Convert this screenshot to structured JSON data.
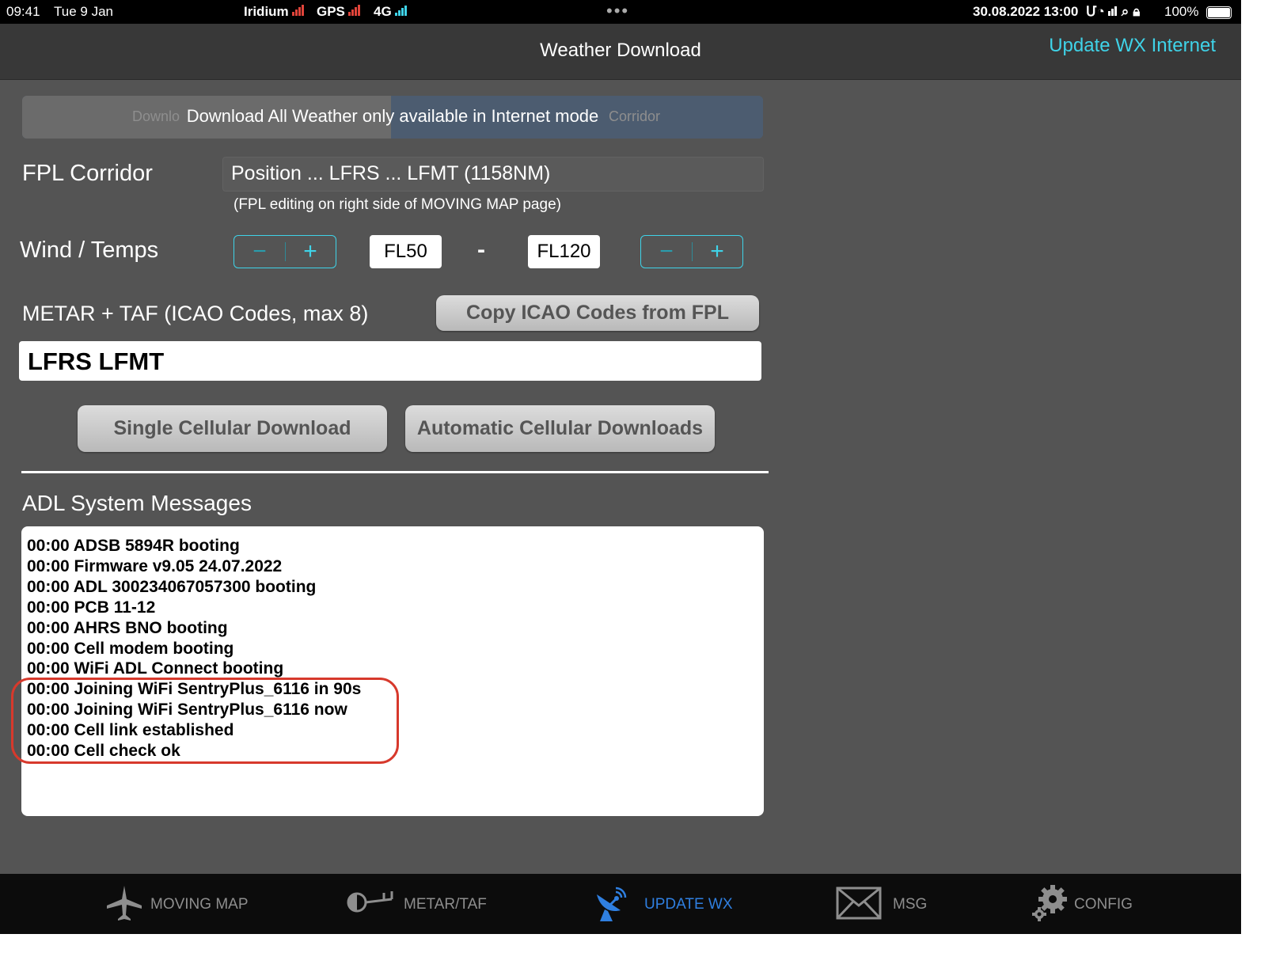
{
  "status_bar": {
    "time": "09:41",
    "date": "Tue 9 Jan",
    "iridium": "Iridium",
    "gps": "GPS",
    "cell": "4G",
    "datetime": "30.08.2022  13:00",
    "battery": "100%"
  },
  "nav": {
    "title": "Weather Download",
    "right_button": "Update WX Internet"
  },
  "segment": {
    "left_ghost": "Downlo",
    "right_ghost": "Corridor",
    "overlay": "Download All Weather only available in Internet mode"
  },
  "fpl": {
    "label": "FPL Corridor",
    "route": "Position ... LFRS ... LFMT (1158NM)",
    "hint": "(FPL editing on right side of MOVING MAP page)"
  },
  "wind": {
    "label": "Wind / Temps",
    "minus": "−",
    "plus": "+",
    "low_level": "FL50",
    "dash": "-",
    "high_level": "FL120"
  },
  "metar": {
    "label": "METAR + TAF (ICAO Codes, max 8)",
    "copy_button": "Copy ICAO Codes from FPL",
    "codes": "LFRS LFMT"
  },
  "actions": {
    "single": "Single Cellular Download",
    "automatic": "Automatic Cellular Downloads"
  },
  "adl": {
    "label": "ADL System Messages",
    "messages": [
      "00:00 ADSB 5894R booting",
      "00:00 Firmware v9.05 24.07.2022",
      "00:00 ADL 300234067057300 booting",
      "00:00 PCB 11-12",
      "00:00 AHRS BNO booting",
      "00:00 Cell modem booting",
      "00:00 WiFi ADL Connect booting",
      "00:00 Joining WiFi SentryPlus_6116 in 90s",
      "00:00 Joining WiFi SentryPlus_6116 now",
      "00:00 Cell link established",
      "00:00 Cell check ok"
    ]
  },
  "tabs": [
    {
      "label": "MOVING MAP",
      "icon": "airplane-icon"
    },
    {
      "label": "METAR/TAF",
      "icon": "windsock-icon"
    },
    {
      "label": "UPDATE WX",
      "icon": "satellite-dish-icon",
      "active": true
    },
    {
      "label": "MSG",
      "icon": "envelope-icon"
    },
    {
      "label": "CONFIG",
      "icon": "gear-icon"
    }
  ],
  "colors": {
    "accent": "#3fd3e8",
    "active_tab": "#2f7fe0",
    "highlight": "#d7392c",
    "background": "#545454"
  }
}
